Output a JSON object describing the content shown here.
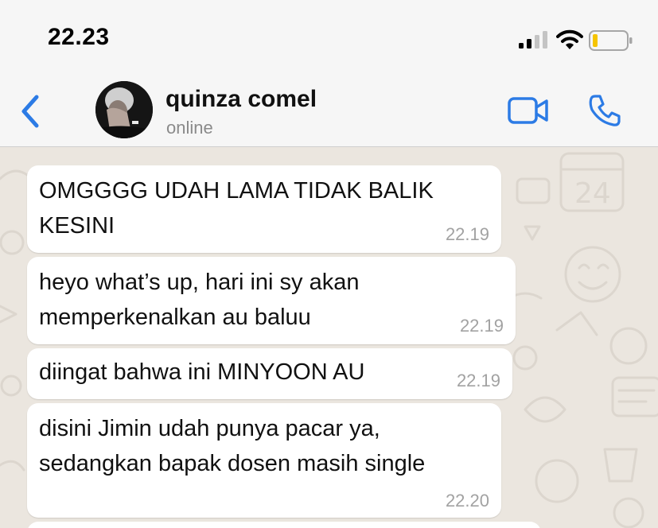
{
  "status_bar": {
    "time": "22.23",
    "icons": [
      "cellular-signal-icon",
      "wifi-icon",
      "battery-low-icon"
    ],
    "battery_color": "#f5c400"
  },
  "header": {
    "back_icon": "chevron-left-icon",
    "contact_name": "quinza comel",
    "contact_status": "online",
    "actions": [
      "video-camera-icon",
      "phone-icon"
    ],
    "accent_color": "#2c7be5"
  },
  "messages": [
    {
      "lines": [
        "OMGGGG UDAH LAMA TIDAK BALIK",
        "KESINI"
      ],
      "time": "22.19"
    },
    {
      "lines": [
        "heyo what’s up, hari ini sy akan",
        "memperkenalkan au baluu"
      ],
      "time": "22.19"
    },
    {
      "lines": [
        "diingat bahwa ini MINYOON AU"
      ],
      "time": "22.19"
    },
    {
      "lines": [
        "disini Jimin udah punya pacar ya,",
        "sedangkan bapak dosen masih single"
      ],
      "time": "22.20"
    }
  ],
  "theme": {
    "chat_background": "#ebe6df",
    "bubble_color": "#ffffff",
    "header_background": "#f6f6f6"
  }
}
